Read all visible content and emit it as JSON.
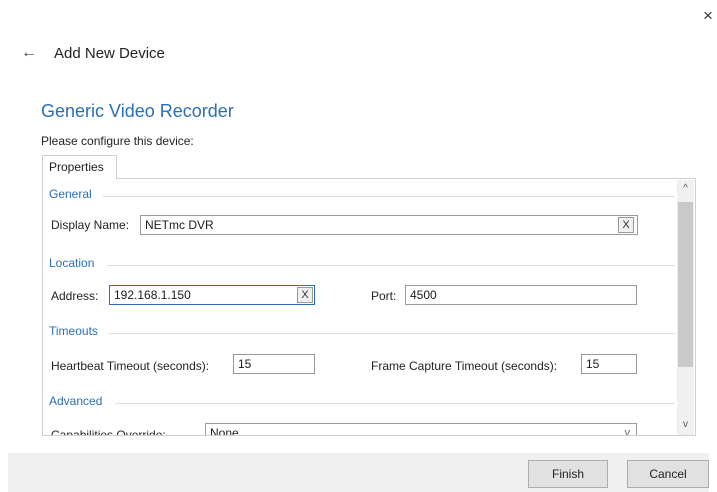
{
  "window": {
    "close_glyph": "×"
  },
  "header": {
    "back_glyph": "←",
    "title": "Add New Device"
  },
  "device": {
    "title": "Generic Video Recorder",
    "instructions": "Please configure this device:"
  },
  "tabs": [
    {
      "label": "Properties"
    }
  ],
  "sections": {
    "general": {
      "title": "General",
      "display_name_label": "Display Name:",
      "display_name_value": "NETmc DVR"
    },
    "location": {
      "title": "Location",
      "address_label": "Address:",
      "address_value": "192.168.1.150",
      "port_label": "Port:",
      "port_value": "4500"
    },
    "timeouts": {
      "title": "Timeouts",
      "heartbeat_label": "Heartbeat Timeout (seconds):",
      "heartbeat_value": "15",
      "frame_capture_label": "Frame Capture Timeout (seconds):",
      "frame_capture_value": "15"
    },
    "advanced": {
      "title": "Advanced",
      "capabilities_label": "Capabilities Override:",
      "capabilities_value": "None"
    }
  },
  "clear_glyph": "X",
  "scroll": {
    "up_glyph": "^",
    "down_glyph": "v"
  },
  "dropdown_glyph": "v",
  "buttons": {
    "finish": "Finish",
    "cancel": "Cancel"
  },
  "colors": {
    "accent": "#2a6fb5",
    "footer_bg": "#f0f0f0"
  },
  "icons": {
    "close": "close-icon",
    "back": "back-arrow-icon"
  }
}
